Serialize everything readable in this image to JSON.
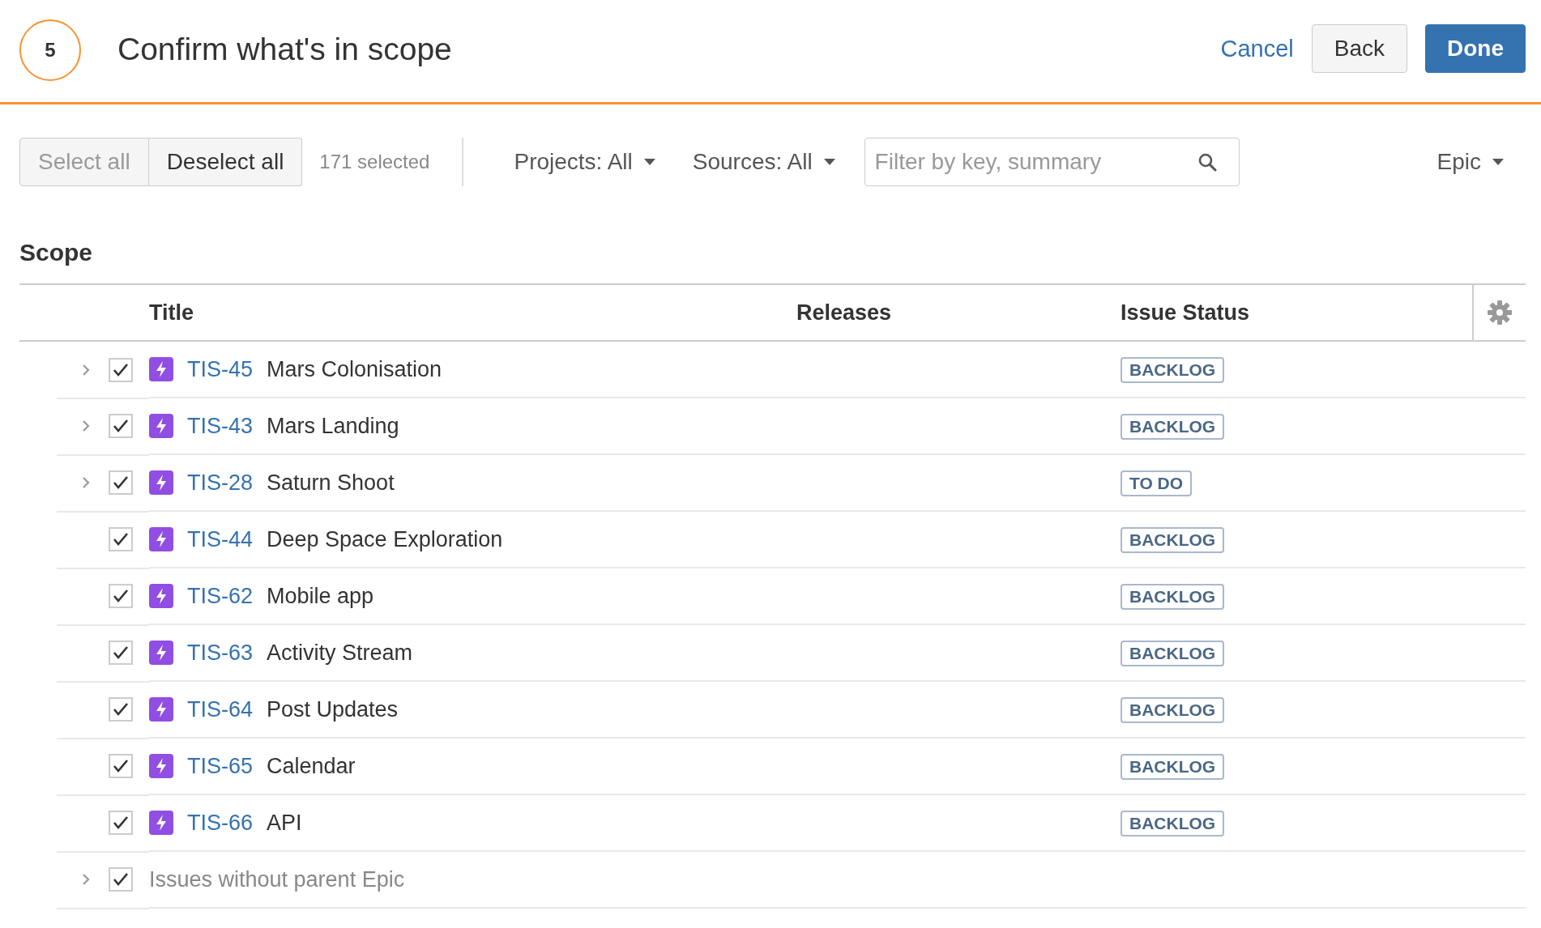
{
  "header": {
    "step": "5",
    "title": "Confirm what's in scope",
    "actions": {
      "cancel": "Cancel",
      "back": "Back",
      "done": "Done"
    }
  },
  "toolbar": {
    "select_all": {
      "label": "Select all",
      "disabled": true
    },
    "deselect_all": {
      "label": "Deselect all",
      "disabled": false
    },
    "selected_count": "171 selected",
    "filters": [
      {
        "label": "Projects: All"
      },
      {
        "label": "Sources: All"
      }
    ],
    "search": {
      "placeholder": "Filter by key, summary"
    },
    "group_by": {
      "label": "Epic"
    }
  },
  "scope": {
    "heading": "Scope",
    "columns": [
      "Title",
      "Releases",
      "Issue Status"
    ],
    "rows": [
      {
        "kind": "epic",
        "expandable": true,
        "checked": true,
        "key": "TIS-45",
        "summary": "Mars Colonisation",
        "status": "BACKLOG"
      },
      {
        "kind": "epic",
        "expandable": true,
        "checked": true,
        "key": "TIS-43",
        "summary": "Mars Landing",
        "status": "BACKLOG"
      },
      {
        "kind": "epic",
        "expandable": true,
        "checked": true,
        "key": "TIS-28",
        "summary": "Saturn Shoot",
        "status": "TO DO"
      },
      {
        "kind": "epic",
        "expandable": false,
        "checked": true,
        "key": "TIS-44",
        "summary": "Deep Space Exploration",
        "status": "BACKLOG"
      },
      {
        "kind": "epic",
        "expandable": false,
        "checked": true,
        "key": "TIS-62",
        "summary": "Mobile app",
        "status": "BACKLOG"
      },
      {
        "kind": "epic",
        "expandable": false,
        "checked": true,
        "key": "TIS-63",
        "summary": "Activity Stream",
        "status": "BACKLOG"
      },
      {
        "kind": "epic",
        "expandable": false,
        "checked": true,
        "key": "TIS-64",
        "summary": "Post Updates",
        "status": "BACKLOG"
      },
      {
        "kind": "epic",
        "expandable": false,
        "checked": true,
        "key": "TIS-65",
        "summary": "Calendar",
        "status": "BACKLOG"
      },
      {
        "kind": "epic",
        "expandable": false,
        "checked": true,
        "key": "TIS-66",
        "summary": "API",
        "status": "BACKLOG"
      },
      {
        "kind": "group",
        "expandable": true,
        "checked": true,
        "label": "Issues without parent Epic"
      }
    ]
  }
}
